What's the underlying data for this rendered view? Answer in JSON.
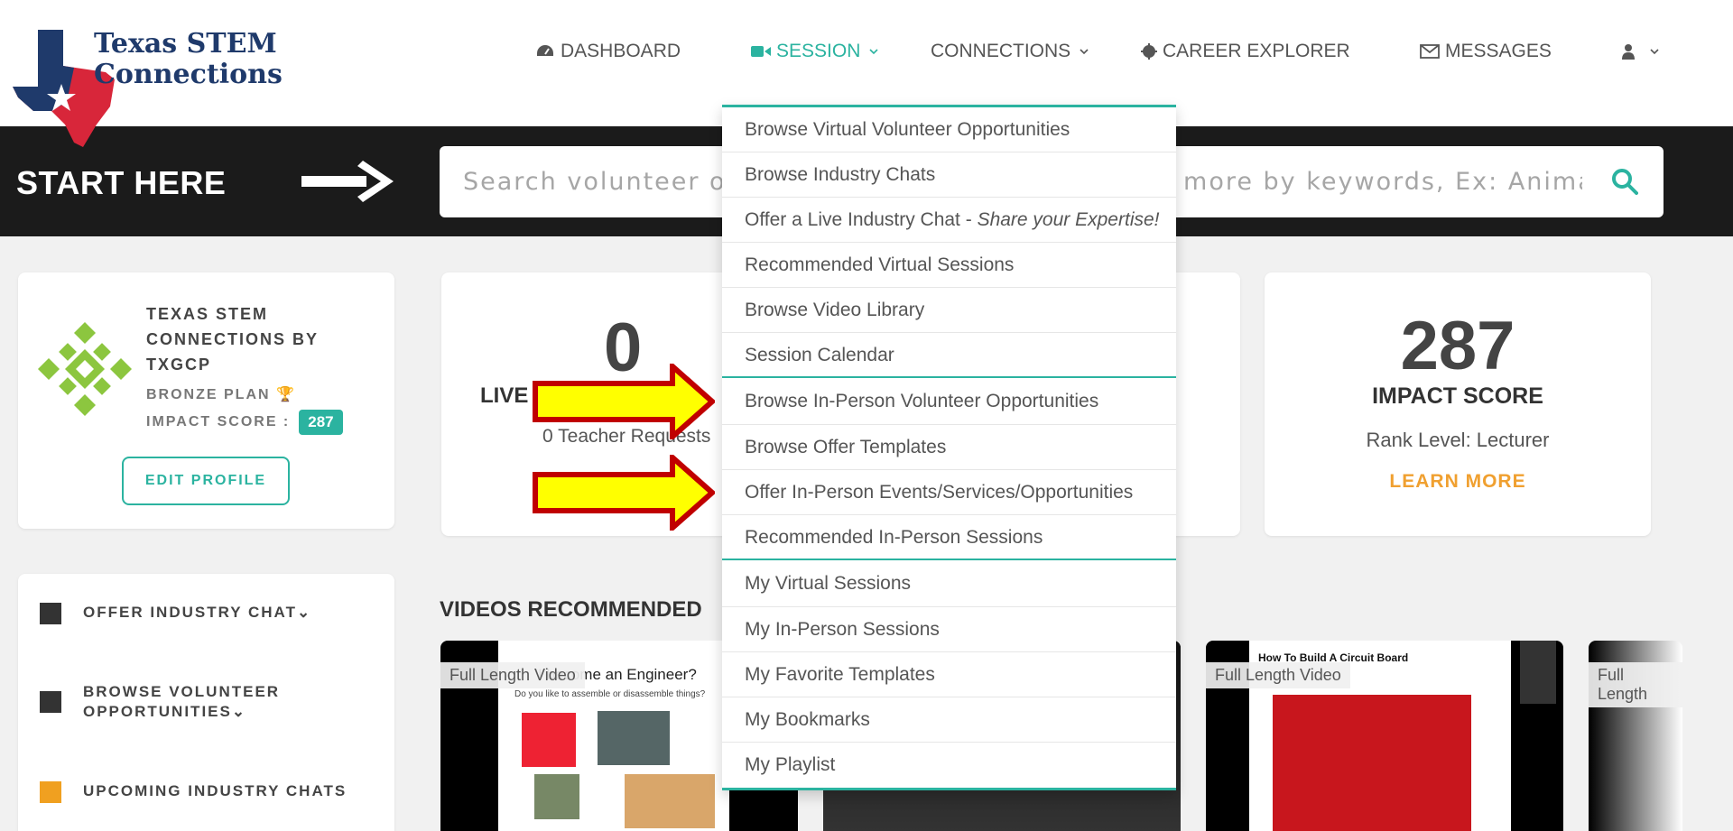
{
  "logo": {
    "line1": "Texas STEM",
    "line2": "Connections"
  },
  "nav": {
    "dashboard": "DASHBOARD",
    "session": "SESSION",
    "connections": "CONNECTIONS",
    "career_explorer": "CAREER EXPLORER",
    "messages": "MESSAGES"
  },
  "band": {
    "start_here": "START HERE",
    "search_placeholder": "Search volunteer opportunities, industry chats and more by keywords, Ex: Animation, Programming"
  },
  "profile": {
    "org_name": "TEXAS STEM CONNECTIONS BY TXGCP",
    "plan": "BRONZE PLAN",
    "impact_label": "IMPACT SCORE :",
    "impact_value": "287",
    "edit_button": "EDIT PROFILE"
  },
  "stat": {
    "number": "0",
    "label": "LIVE",
    "sub": "0 Teacher Requests"
  },
  "score": {
    "number": "287",
    "label": "IMPACT SCORE",
    "rank": "Rank Level: Lecturer",
    "learn_more": "LEARN MORE"
  },
  "side_menu": [
    {
      "label": "OFFER INDUSTRY CHAT",
      "color": "#333333"
    },
    {
      "label": "BROWSE VOLUNTEER OPPORTUNITIES",
      "color": "#333333"
    },
    {
      "label": "UPCOMING INDUSTRY CHATS",
      "color": "#f0a020"
    }
  ],
  "videos": {
    "title": "VIDEOS RECOMMENDED",
    "tag": "Full Length Video",
    "tag_partial": "Full Length",
    "v1_caption": "I become an Engineer?",
    "v1_sub": "Do you like to assemble or disassemble things?",
    "v3_caption": "How To Build A Circuit Board"
  },
  "dropdown": {
    "items": [
      "Browse Virtual Volunteer Opportunities",
      "Browse Industry Chats",
      "Offer a Live Industry Chat - ",
      "Recommended Virtual Sessions",
      "Browse Video Library",
      "Session Calendar",
      "Browse In-Person Volunteer Opportunities",
      "Browse Offer Templates",
      "Offer In-Person Events/Services/Opportunities",
      "Recommended In-Person Sessions",
      "My Virtual Sessions",
      "My In-Person Sessions",
      "My Favorite Templates",
      "My Bookmarks",
      "My Playlist"
    ],
    "emphasis": "Share your Expertise!"
  },
  "colors": {
    "accent": "#2bb3a0",
    "orange": "#f0a030",
    "band": "#1b1b1b",
    "arrow_fill": "#ffff00",
    "arrow_stroke": "#c00000"
  }
}
